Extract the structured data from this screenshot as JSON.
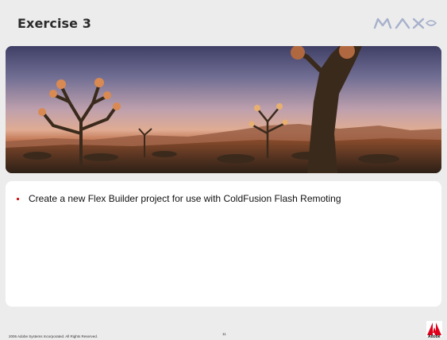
{
  "slide": {
    "title": "Exercise 3",
    "bullets": [
      "Create a new Flex Builder project for use with ColdFusion Flash Remoting"
    ]
  },
  "footer": {
    "copyright": "2006 Adobe Systems Incorporated.  All Rights Reserved.",
    "page_number": "11",
    "adobe_word": "Adobe"
  },
  "logos": {
    "event_logo": "MAX",
    "brand_logo": "Adobe"
  },
  "colors": {
    "background": "#ececec",
    "bullet_accent": "#d01f1f",
    "adobe_red": "#e0001b"
  }
}
